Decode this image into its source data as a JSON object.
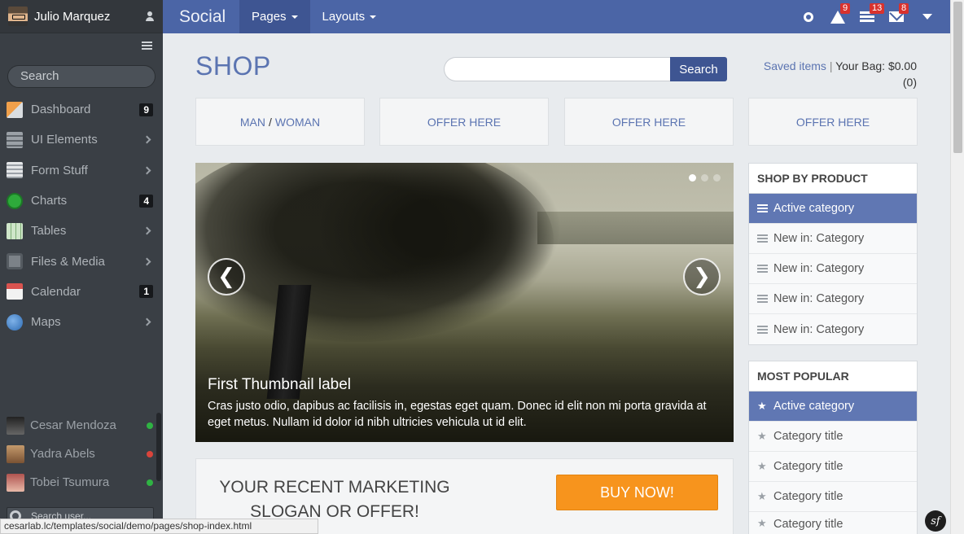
{
  "sidebar": {
    "user_name": "Julio Marquez",
    "search_placeholder": "Search",
    "nav": [
      {
        "label": "Dashboard",
        "badge": "9",
        "icon": "home-icon"
      },
      {
        "label": "UI Elements",
        "icon": "ui-elements-icon"
      },
      {
        "label": "Form Stuff",
        "icon": "form-icon"
      },
      {
        "label": "Charts",
        "badge": "4",
        "icon": "charts-icon"
      },
      {
        "label": "Tables",
        "icon": "tables-icon"
      },
      {
        "label": "Files & Media",
        "icon": "camera-icon"
      },
      {
        "label": "Calendar",
        "badge": "1",
        "icon": "calendar-icon"
      },
      {
        "label": "Maps",
        "icon": "globe-icon"
      }
    ],
    "contacts": [
      {
        "name": "Cesar Mendoza",
        "status": "online"
      },
      {
        "name": "Yadra Abels",
        "status": "busy"
      },
      {
        "name": "Tobei Tsumura",
        "status": "online"
      }
    ],
    "search_user_placeholder": "Search user..."
  },
  "topbar": {
    "brand": "Social",
    "menus": [
      "Pages",
      "Layouts"
    ],
    "warnings_count": "9",
    "tasks_count": "13",
    "messages_count": "8"
  },
  "main": {
    "title": "SHOP",
    "search_button": "Search",
    "saved_items": "Saved items",
    "bag_separator": "|",
    "bag_label": "Your Bag: $0.00",
    "bag_count": "(0)",
    "offers": {
      "man": "MAN",
      "slash": "/",
      "woman": "WOMAN",
      "offer_2": "OFFER HERE",
      "offer_3": "OFFER HERE",
      "offer_4": "OFFER HERE"
    },
    "carousel": {
      "caption_title": "First Thumbnail label",
      "caption_text": "Cras justo odio, dapibus ac facilisis in, egestas eget quam. Donec id elit non mi porta gravida at eget metus. Nullam id dolor id nibh ultricies vehicula ut id elit.",
      "prev_glyph": "❮",
      "next_glyph": "❯"
    },
    "slogan": "YOUR RECENT MARKETING SLOGAN OR OFFER!",
    "buy_button": "BUY NOW!"
  },
  "shop_by_product": {
    "heading": "SHOP BY PRODUCT",
    "items": [
      "Active category",
      "New in: Category",
      "New in: Category",
      "New in: Category",
      "New in: Category"
    ]
  },
  "most_popular": {
    "heading": "MOST POPULAR",
    "star_glyph": "★",
    "items": [
      "Active category",
      "Category title",
      "Category title",
      "Category title",
      "Category title"
    ]
  },
  "status_bar": {
    "url": "cesarlab.lc/templates/social/demo/pages/shop-index.html"
  },
  "sf_badge": "sf",
  "colors": {
    "sidebar_bg": "#3a3f45",
    "topbar_bg": "#4b65a6",
    "accent": "#5b74b1",
    "buy_button": "#f7941d",
    "active_item": "#6077b3"
  }
}
